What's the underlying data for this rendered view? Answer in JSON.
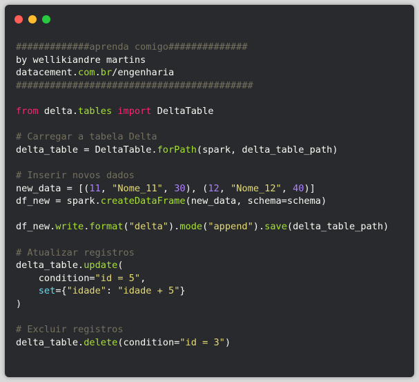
{
  "window": {
    "controls": [
      {
        "name": "close-button",
        "color": "#ff5f56"
      },
      {
        "name": "minimize-button",
        "color": "#ffbd2e"
      },
      {
        "name": "maximize-button",
        "color": "#27c93f"
      }
    ]
  },
  "colors": {
    "default": "#f8f8f2",
    "comment": "#75715e",
    "keyword": "#f92672",
    "function": "#a6e22e",
    "string": "#e6db74",
    "number": "#ae81ff",
    "param": "#66d9ef",
    "domain": "#a6e22e"
  },
  "code_lines": [
    [
      {
        "t": "#############aprenda comigo##############",
        "c": "comment"
      }
    ],
    [
      {
        "t": "by wellikiandre martins",
        "c": "default"
      }
    ],
    [
      {
        "t": "datacement.",
        "c": "default"
      },
      {
        "t": "com",
        "c": "domain"
      },
      {
        "t": ".",
        "c": "default"
      },
      {
        "t": "br",
        "c": "domain"
      },
      {
        "t": "/engenharia",
        "c": "default"
      }
    ],
    [
      {
        "t": "##########################################",
        "c": "comment"
      }
    ],
    [],
    [
      {
        "t": "from",
        "c": "keyword"
      },
      {
        "t": " delta.",
        "c": "default"
      },
      {
        "t": "tables",
        "c": "domain"
      },
      {
        "t": " ",
        "c": "default"
      },
      {
        "t": "import",
        "c": "keyword"
      },
      {
        "t": " DeltaTable",
        "c": "default"
      }
    ],
    [],
    [
      {
        "t": "# Carregar a tabela Delta",
        "c": "comment"
      }
    ],
    [
      {
        "t": "delta_table = DeltaTable.",
        "c": "default"
      },
      {
        "t": "forPath",
        "c": "function"
      },
      {
        "t": "(spark, delta_table_path)",
        "c": "default"
      }
    ],
    [],
    [
      {
        "t": "# Inserir novos dados",
        "c": "comment"
      }
    ],
    [
      {
        "t": "new_data = [(",
        "c": "default"
      },
      {
        "t": "11",
        "c": "number"
      },
      {
        "t": ", ",
        "c": "default"
      },
      {
        "t": "\"Nome_11\"",
        "c": "string"
      },
      {
        "t": ", ",
        "c": "default"
      },
      {
        "t": "30",
        "c": "number"
      },
      {
        "t": "), (",
        "c": "default"
      },
      {
        "t": "12",
        "c": "number"
      },
      {
        "t": ", ",
        "c": "default"
      },
      {
        "t": "\"Nome_12\"",
        "c": "string"
      },
      {
        "t": ", ",
        "c": "default"
      },
      {
        "t": "40",
        "c": "number"
      },
      {
        "t": ")]",
        "c": "default"
      }
    ],
    [
      {
        "t": "df_new = spark.",
        "c": "default"
      },
      {
        "t": "createDataFrame",
        "c": "function"
      },
      {
        "t": "(new_data, schema=schema)",
        "c": "default"
      }
    ],
    [],
    [
      {
        "t": "df_new.",
        "c": "default"
      },
      {
        "t": "write",
        "c": "function"
      },
      {
        "t": ".",
        "c": "default"
      },
      {
        "t": "format",
        "c": "function"
      },
      {
        "t": "(",
        "c": "default"
      },
      {
        "t": "\"delta\"",
        "c": "string"
      },
      {
        "t": ").",
        "c": "default"
      },
      {
        "t": "mode",
        "c": "function"
      },
      {
        "t": "(",
        "c": "default"
      },
      {
        "t": "\"append\"",
        "c": "string"
      },
      {
        "t": ").",
        "c": "default"
      },
      {
        "t": "save",
        "c": "function"
      },
      {
        "t": "(delta_table_path)",
        "c": "default"
      }
    ],
    [],
    [
      {
        "t": "# Atualizar registros",
        "c": "comment"
      }
    ],
    [
      {
        "t": "delta_table.",
        "c": "default"
      },
      {
        "t": "update",
        "c": "function"
      },
      {
        "t": "(",
        "c": "default"
      }
    ],
    [
      {
        "t": "    condition=",
        "c": "default"
      },
      {
        "t": "\"id = 5\"",
        "c": "string"
      },
      {
        "t": ",",
        "c": "default"
      }
    ],
    [
      {
        "t": "    ",
        "c": "default"
      },
      {
        "t": "set",
        "c": "param"
      },
      {
        "t": "={",
        "c": "default"
      },
      {
        "t": "\"idade\"",
        "c": "string"
      },
      {
        "t": ": ",
        "c": "default"
      },
      {
        "t": "\"idade + 5\"",
        "c": "string"
      },
      {
        "t": "}",
        "c": "default"
      }
    ],
    [
      {
        "t": ")",
        "c": "default"
      }
    ],
    [],
    [
      {
        "t": "# Excluir registros",
        "c": "comment"
      }
    ],
    [
      {
        "t": "delta_table.",
        "c": "default"
      },
      {
        "t": "delete",
        "c": "function"
      },
      {
        "t": "(condition=",
        "c": "default"
      },
      {
        "t": "\"id = 3\"",
        "c": "string"
      },
      {
        "t": ")",
        "c": "default"
      }
    ]
  ]
}
